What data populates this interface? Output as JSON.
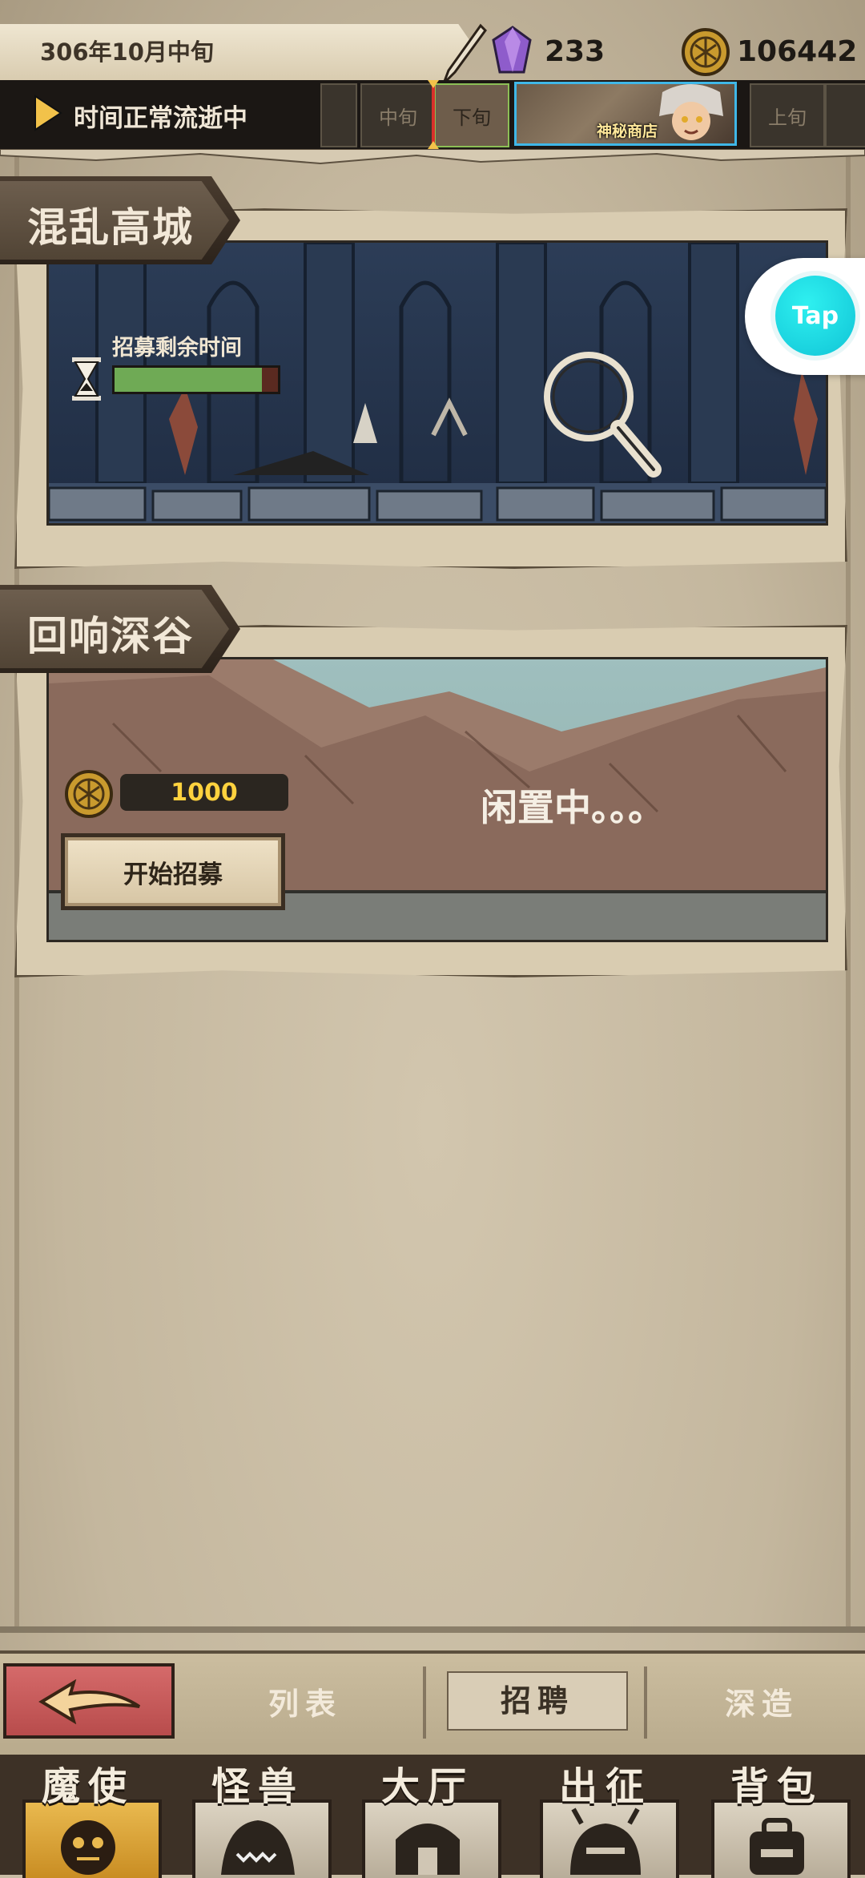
{
  "header": {
    "date": "306年10月中旬",
    "gems": "233",
    "gold": "106442",
    "time_status": "时间正常流逝中",
    "calendar_cells": [
      "",
      "中旬",
      "下旬",
      "上旬",
      ""
    ],
    "shop_label": "神秘商店"
  },
  "locations": [
    {
      "title": "混乱高城",
      "recruit_time_label": "招募剩余时间",
      "recruit_progress": 0.9
    },
    {
      "title": "回响深谷",
      "cost": "1000",
      "start_button": "开始招募",
      "status": "闲置中。。。"
    }
  ],
  "floating": {
    "tap_label": "Tap"
  },
  "sub_tabs": {
    "list": "列表",
    "recruit": "招聘",
    "deep": "深造"
  },
  "nav": [
    "魔使",
    "怪兽",
    "大厅",
    "出征",
    "背包"
  ],
  "colors": {
    "accent_gold": "#ffd23e",
    "progress_green": "#6faa55",
    "tap_cyan": "#10c4d6",
    "shop_border": "#3fb7e8"
  }
}
